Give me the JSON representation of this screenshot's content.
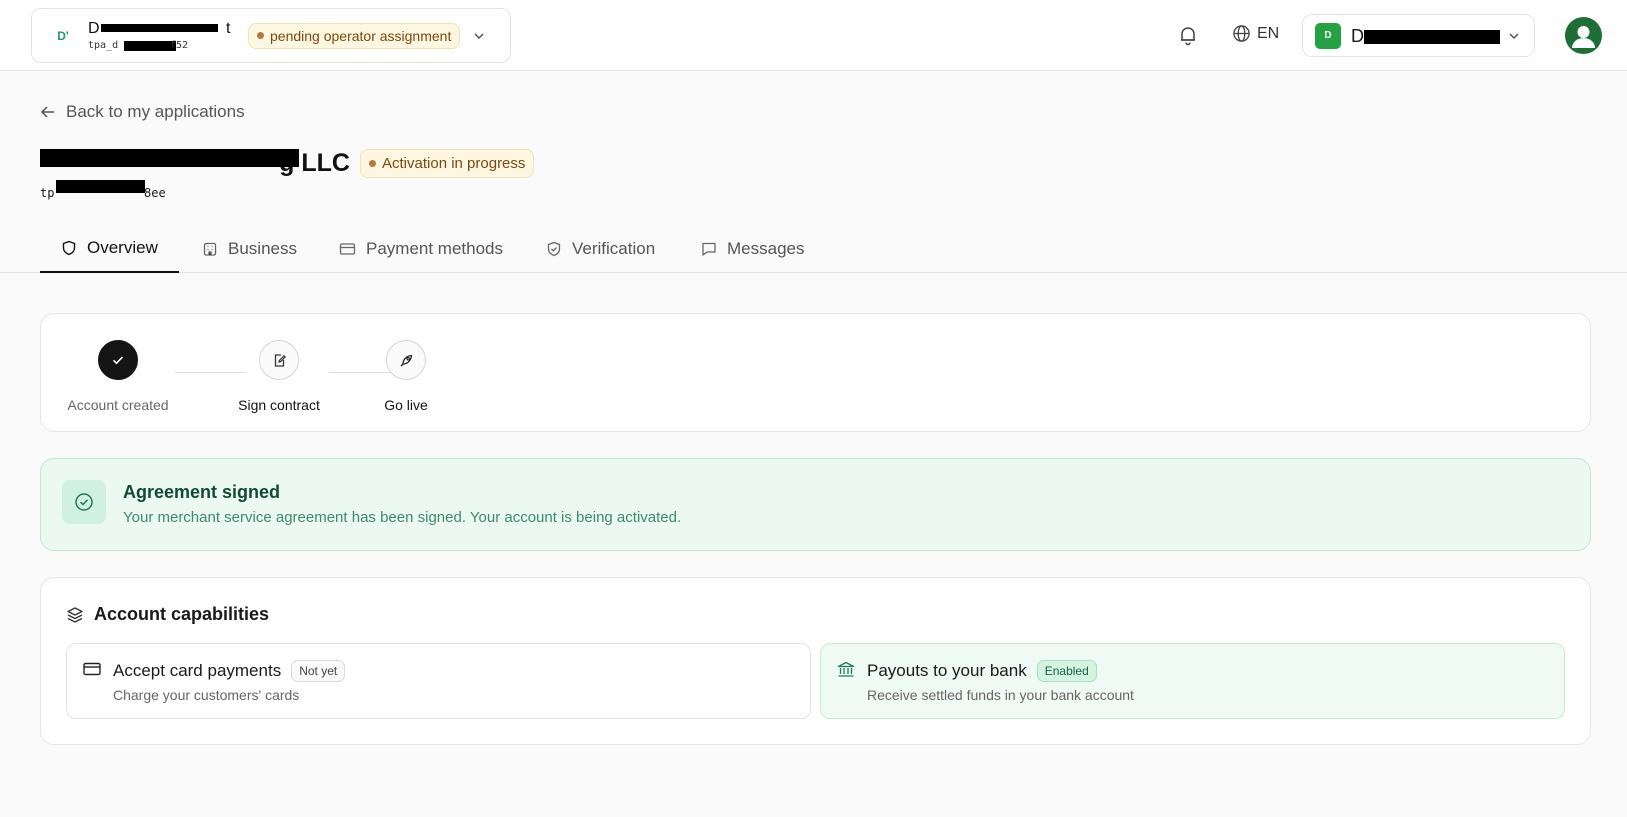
{
  "header": {
    "org": {
      "logo_text": "D'",
      "name_start": "D",
      "name_end": "t",
      "id_start": "tpa_d",
      "id_end": "f52",
      "status": "pending operator assignment"
    },
    "language": "EN",
    "account": {
      "logo_text": "D",
      "name_start": "D"
    }
  },
  "page": {
    "back_label": "Back to my applications",
    "company_name_end": "g LLC",
    "company_status": "Activation in progress",
    "company_id_start": "tp",
    "company_id_end": "8ee"
  },
  "tabs": [
    {
      "label": "Overview",
      "icon": "shield-icon",
      "active": true
    },
    {
      "label": "Business",
      "icon": "building-icon"
    },
    {
      "label": "Payment methods",
      "icon": "card-icon"
    },
    {
      "label": "Verification",
      "icon": "shield-check-icon"
    },
    {
      "label": "Messages",
      "icon": "message-icon"
    }
  ],
  "steps": [
    {
      "label": "Account created",
      "state": "done"
    },
    {
      "label": "Sign contract",
      "state": "current"
    },
    {
      "label": "Go live",
      "state": "pending"
    }
  ],
  "agreement": {
    "title": "Agreement signed",
    "text": "Your merchant service agreement has been signed. Your account is being activated."
  },
  "capabilities": {
    "title": "Account capabilities",
    "items": [
      {
        "name": "Accept card payments",
        "status": "Not yet",
        "desc": "Charge your customers' cards"
      },
      {
        "name": "Payouts to your bank",
        "status": "Enabled",
        "desc": "Receive settled funds in your bank account"
      }
    ]
  },
  "colors": {
    "accent_green": "#1f9d6b",
    "pending_badge_bg": "#fdf6e1",
    "success_bg": "#ebf9f2"
  }
}
